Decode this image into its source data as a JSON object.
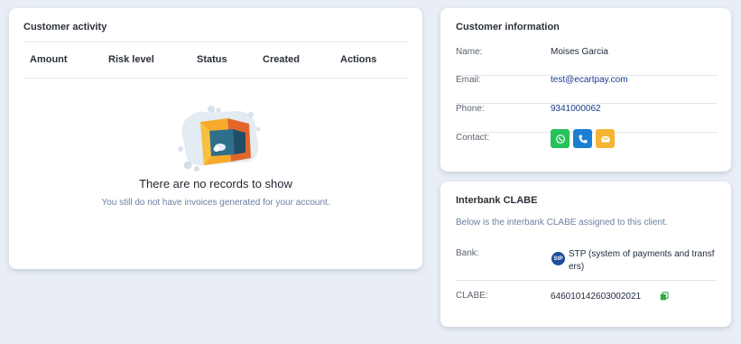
{
  "activity": {
    "title": "Customer activity",
    "columns": [
      "Amount",
      "Risk level",
      "Status",
      "Created",
      "Actions"
    ],
    "empty_title": "There are no records to show",
    "empty_subtitle": "You still do not have invoices generated for your account."
  },
  "info": {
    "title": "Customer information",
    "name_label": "Name:",
    "name_value": "Moises Garcia",
    "email_label": "Email:",
    "email_value": "test@ecartpay.com",
    "phone_label": "Phone:",
    "phone_value": "9341000062",
    "contact_label": "Contact:",
    "contact_buttons": [
      {
        "icon": "whatsapp-icon",
        "color": "#25c25a"
      },
      {
        "icon": "phone-icon",
        "color": "#1d7fd1"
      },
      {
        "icon": "mail-icon",
        "color": "#f5b532"
      }
    ]
  },
  "clabe": {
    "title": "Interbank CLABE",
    "description": "Below is the interbank CLABE assigned to this client.",
    "bank_label": "Bank:",
    "bank_value": "STP (system of payments and transfers)",
    "bank_logo_text": "StP",
    "clabe_label": "CLABE:",
    "clabe_value": "646010142603002021",
    "copy_icon_color": "#2eaa3c"
  }
}
